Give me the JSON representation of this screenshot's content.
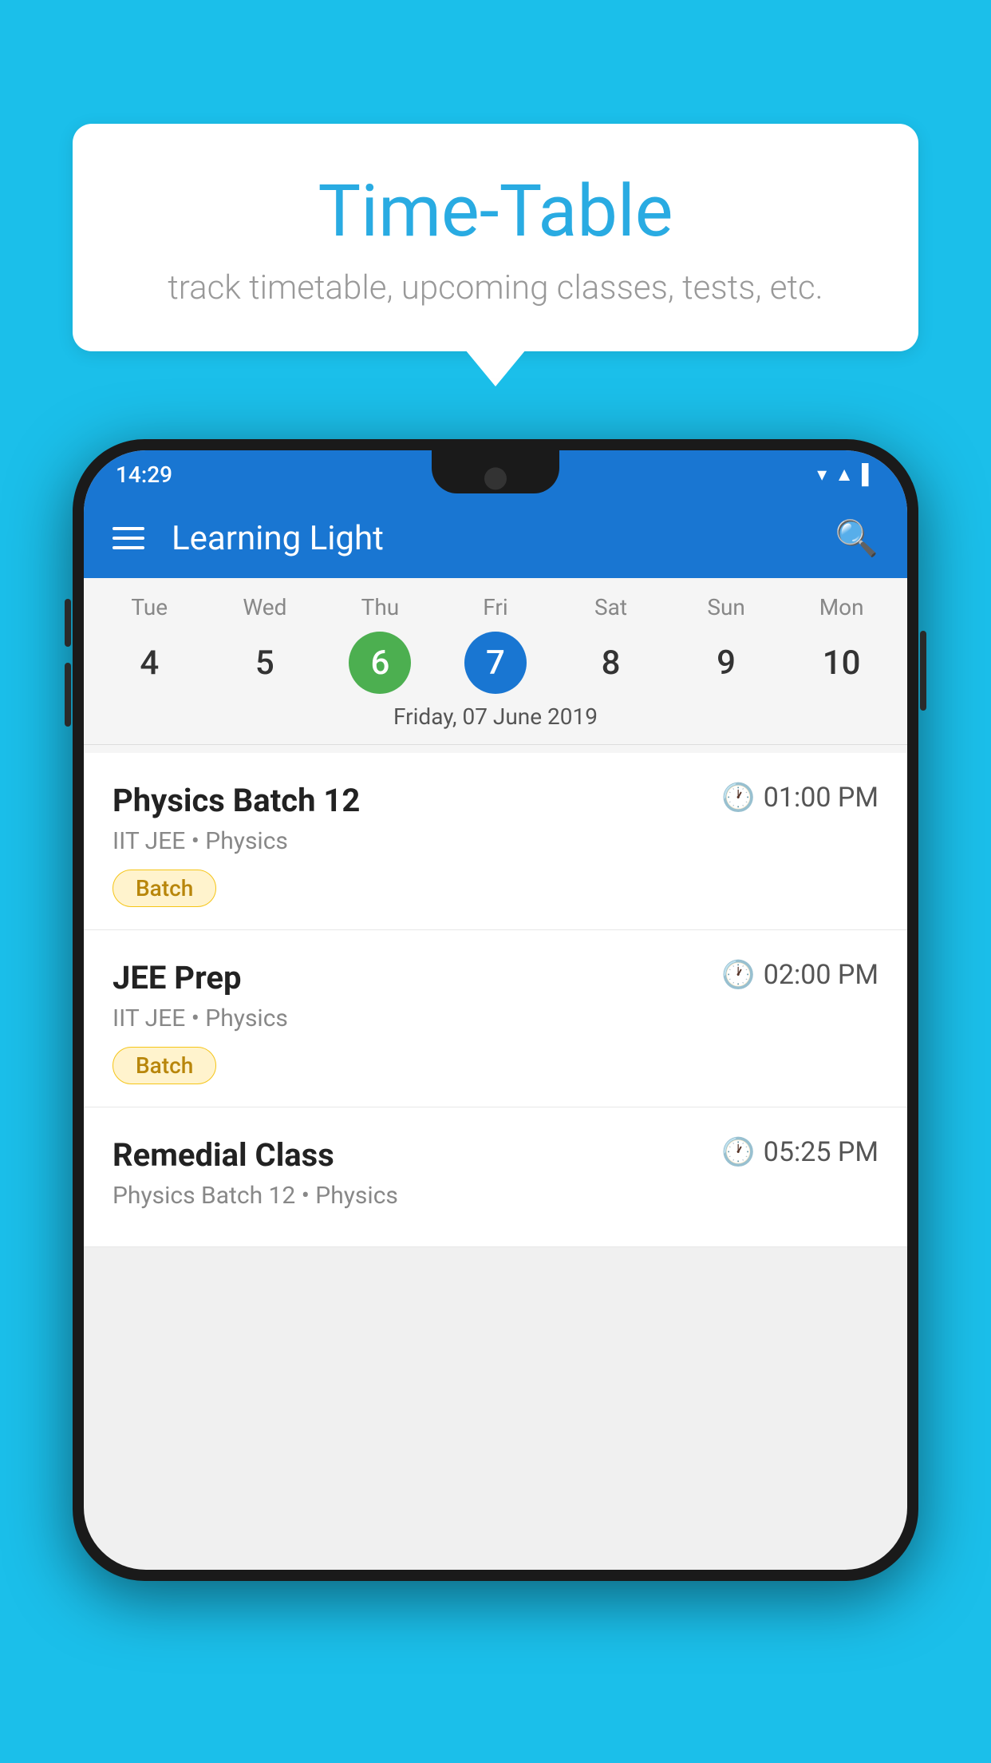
{
  "background_color": "#1BBFEA",
  "bubble": {
    "title": "Time-Table",
    "subtitle": "track timetable, upcoming classes, tests, etc."
  },
  "phone": {
    "status_bar": {
      "time": "14:29",
      "icons": [
        "▾",
        "▲",
        "▌"
      ]
    },
    "app_bar": {
      "title": "Learning Light",
      "search_icon": "🔍"
    },
    "calendar": {
      "days": [
        {
          "name": "Tue",
          "num": "4",
          "state": "normal"
        },
        {
          "name": "Wed",
          "num": "5",
          "state": "normal"
        },
        {
          "name": "Thu",
          "num": "6",
          "state": "today"
        },
        {
          "name": "Fri",
          "num": "7",
          "state": "selected"
        },
        {
          "name": "Sat",
          "num": "8",
          "state": "normal"
        },
        {
          "name": "Sun",
          "num": "9",
          "state": "normal"
        },
        {
          "name": "Mon",
          "num": "10",
          "state": "normal"
        }
      ],
      "selected_date_label": "Friday, 07 June 2019"
    },
    "schedule": [
      {
        "title": "Physics Batch 12",
        "time": "01:00 PM",
        "sub": "IIT JEE • Physics",
        "badge": "Batch"
      },
      {
        "title": "JEE Prep",
        "time": "02:00 PM",
        "sub": "IIT JEE • Physics",
        "badge": "Batch"
      },
      {
        "title": "Remedial Class",
        "time": "05:25 PM",
        "sub": "Physics Batch 12 • Physics",
        "badge": null
      }
    ]
  }
}
